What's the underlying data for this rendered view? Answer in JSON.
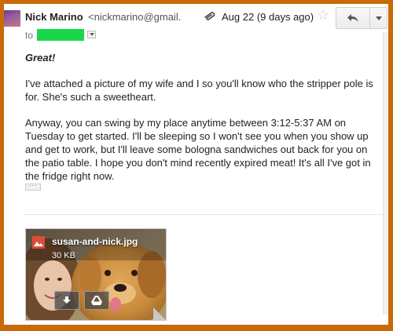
{
  "header": {
    "sender_name": "Nick Marino",
    "sender_email": "<nickmarino@gmail.",
    "date": "Aug 22 (9 days ago)",
    "to_label": "to",
    "icons": {
      "attachment": "paperclip-icon",
      "star": "star-icon",
      "reply": "reply-arrow-icon",
      "more": "chevron-down-icon"
    }
  },
  "message": {
    "greeting": "Great!",
    "paragraphs": [
      "I've attached a picture of my wife and I so you'll know who the stripper pole is for. She's such a sweetheart.",
      "Anyway, you can swing by my place anytime between 3:12-5:37 AM on Tuesday to get started. I'll be sleeping so I won't see you when you show up and get to work, but I'll leave some bologna sandwiches out back for you on the patio table. I hope you don't mind recently expired meat! It's all I've got in the fridge right now."
    ],
    "expand_label": "···"
  },
  "attachment": {
    "file_name": "susan-and-nick.jpg",
    "file_size": "30 KB",
    "icons": {
      "file_type": "image-file-icon",
      "download": "download-icon",
      "drive": "drive-icon"
    }
  },
  "colors": {
    "frame_border": "#c96a07",
    "recipient_redaction": "#1ad64a",
    "image_file_icon": "#dd4b39"
  }
}
